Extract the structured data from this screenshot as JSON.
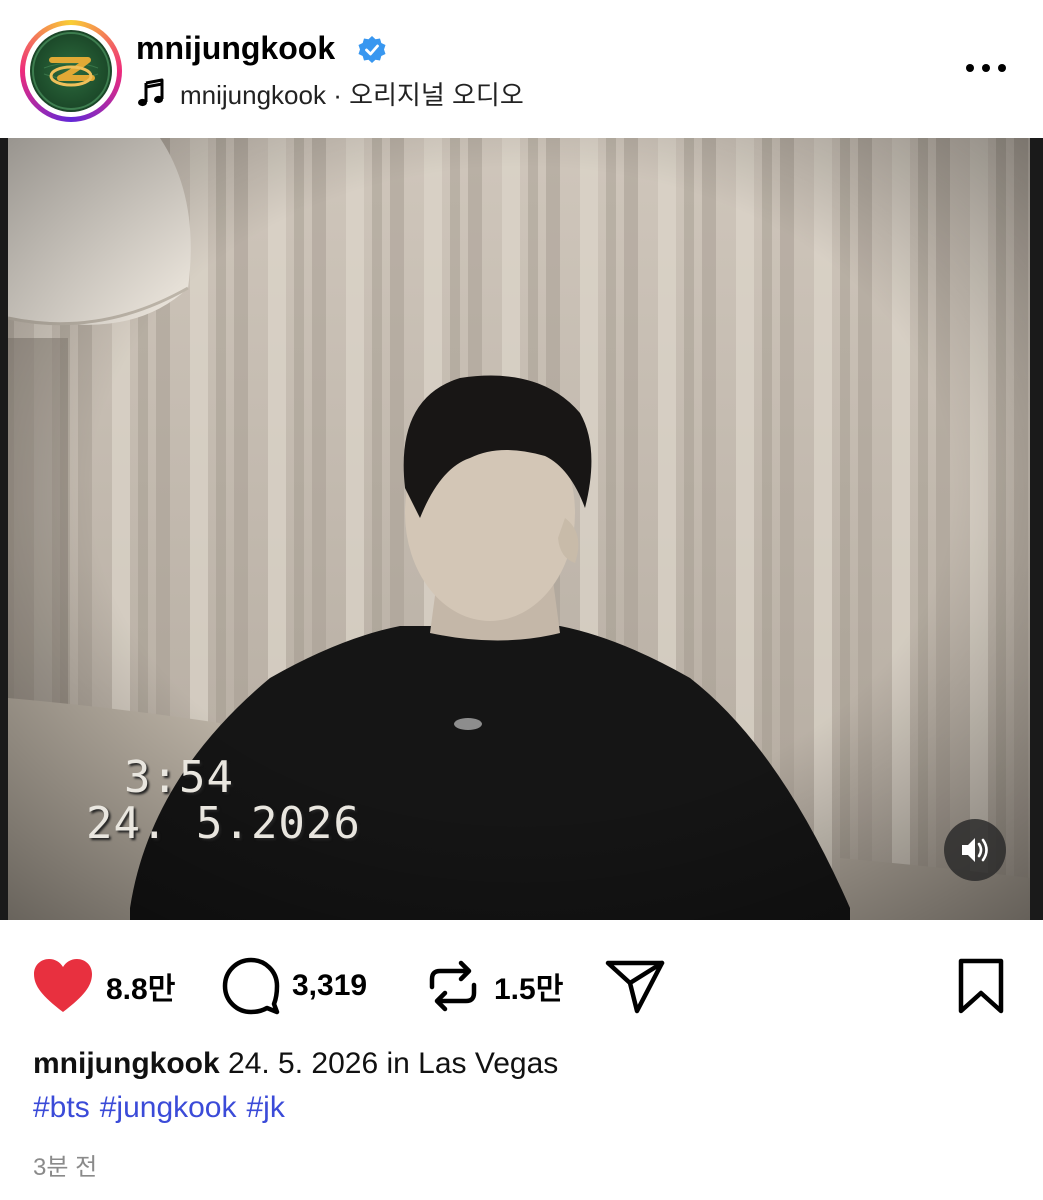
{
  "post": {
    "author": "mnijungkook",
    "verified": true,
    "audio": "mnijungkook · 오리지널 오디오",
    "video_overlay": {
      "time": "3:54",
      "date": "24. 5.2026"
    },
    "actions": {
      "likes": "8.8만",
      "comments": "3,319",
      "reposts": "1.5만"
    },
    "caption": {
      "user": "mnijungkook",
      "text": "24. 5. 2026 in Las Vegas"
    },
    "hashtags": [
      "#bts",
      "#jungkook",
      "#jk"
    ],
    "time_ago": "3분 전"
  },
  "colors": {
    "like_red": "#e8303f",
    "hashtag_blue": "#3b4bd8",
    "verified_blue": "#3897f0"
  },
  "icons": [
    "verified-icon",
    "music-note-icon",
    "more-icon",
    "mute-icon",
    "heart-icon",
    "comment-icon",
    "repost-icon",
    "share-icon",
    "bookmark-icon"
  ]
}
